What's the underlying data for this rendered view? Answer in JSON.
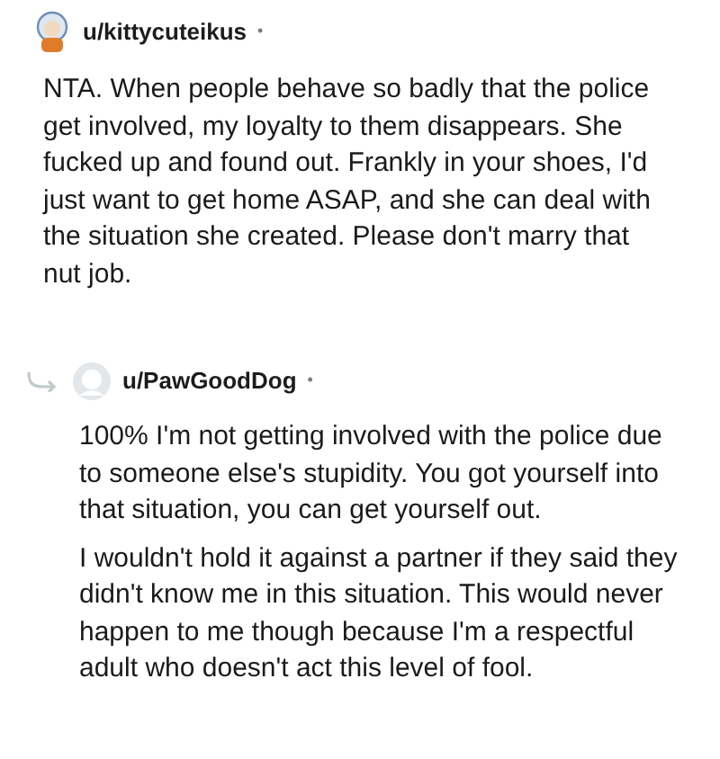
{
  "comments": [
    {
      "author": "u/kittycuteikus",
      "separator": "•",
      "reply": false,
      "paragraphs": [
        "NTA. When people behave so badly that the police get involved, my loyalty to them disappears. She fucked up and found out. Frankly in your shoes, I'd just want to get home ASAP, and she can deal with the situation she created. Please don't marry that nut job."
      ]
    },
    {
      "author": "u/PawGoodDog",
      "separator": "•",
      "reply": true,
      "paragraphs": [
        "100% I'm not getting involved with the police due to someone else's stupidity. You got yourself into that situation, you can get yourself out.",
        "I wouldn't hold it against a partner if they said they didn't know me in this situation. This would never happen to me though because I'm a respectful adult who doesn't act this level of fool."
      ]
    }
  ]
}
